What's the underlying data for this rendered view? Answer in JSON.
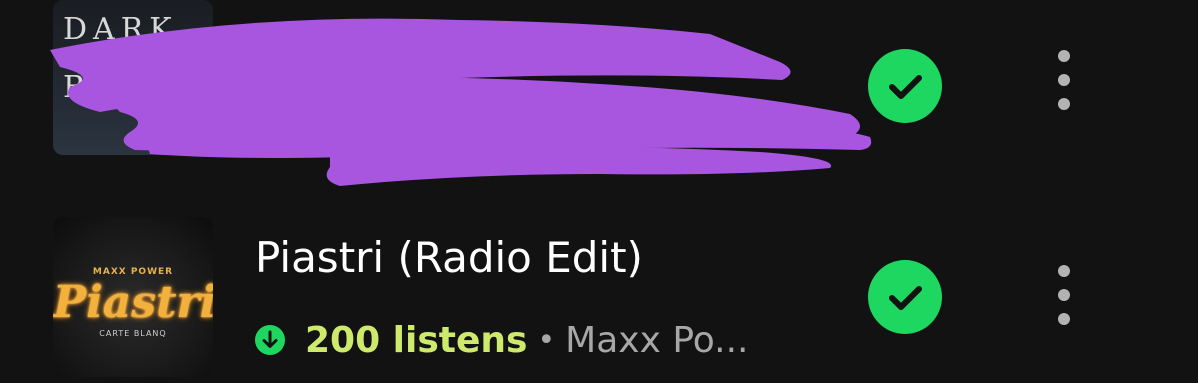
{
  "tracks": [
    {
      "cover": {
        "text_top": "DARK",
        "text_mid": "BL"
      },
      "title": "",
      "redacted": true,
      "saved": true,
      "icons": {
        "saved": "check-circle-icon",
        "more": "more-vertical-icon"
      }
    },
    {
      "cover": {
        "brand": "MAXX POWER",
        "title": "Piastri",
        "subtitle": "CARTE BLANQ"
      },
      "title": "Piastri (Radio Edit)",
      "listens": "200 listens",
      "separator": "•",
      "artist": "Maxx Po...",
      "downloaded": true,
      "saved": true,
      "icons": {
        "download": "download-icon",
        "saved": "check-circle-icon",
        "more": "more-vertical-icon"
      }
    }
  ],
  "colors": {
    "background": "#121212",
    "accent_green": "#1ed760",
    "listens_color": "#cdea6c",
    "secondary_text": "#a7a7a7",
    "redaction": "#a855e0"
  }
}
